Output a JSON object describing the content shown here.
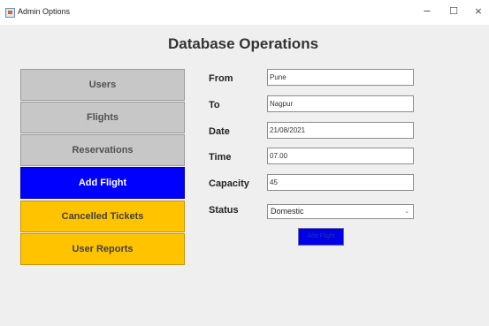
{
  "window": {
    "title": "Admin Options",
    "controls": {
      "minimize": "−",
      "maximize": "☐",
      "close": "×"
    }
  },
  "heading": "Database Operations",
  "nav": [
    {
      "label": "Users"
    },
    {
      "label": "Flights"
    },
    {
      "label": "Reservations"
    },
    {
      "label": "Add Flight"
    },
    {
      "label": "Cancelled Tickets"
    },
    {
      "label": "User Reports"
    }
  ],
  "form": {
    "from": {
      "label": "From",
      "value": "Pune"
    },
    "to": {
      "label": "To",
      "value": "Nagpur"
    },
    "date": {
      "label": "Date",
      "value": "21/08/2021"
    },
    "time": {
      "label": "Time",
      "value": "07.00"
    },
    "capacity": {
      "label": "Capacity",
      "value": "45"
    },
    "status": {
      "label": "Status",
      "value": "Domestic"
    },
    "submit_label": "Add Flight"
  },
  "colors": {
    "active": "#0000ff",
    "highlight": "#ffc300",
    "neutral": "#c7c7c7"
  }
}
